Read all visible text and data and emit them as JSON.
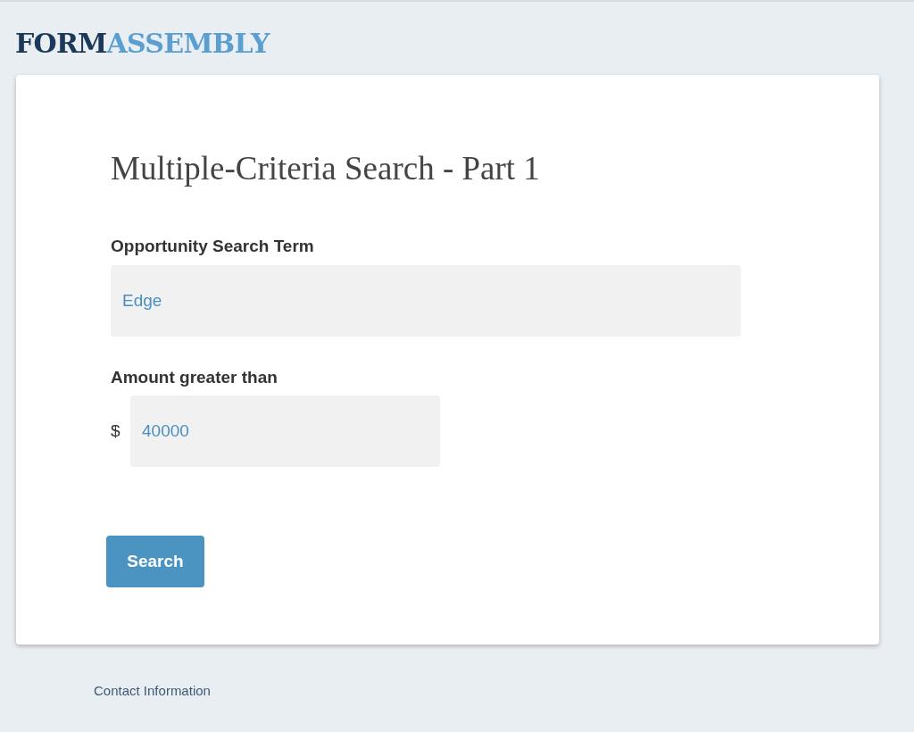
{
  "logo": [
    "FORM",
    "ASSEMBLY"
  ],
  "form": {
    "title": "Multiple-Criteria Search - Part 1",
    "fields": [
      {
        "kind": "text",
        "label": "Opportunity Search Term",
        "value": "Edge"
      },
      {
        "kind": "currency",
        "label": "Amount greater than",
        "prefix": "$",
        "value": "40000"
      }
    ],
    "submit": "Search"
  },
  "footer": {
    "link": "Contact Information"
  }
}
